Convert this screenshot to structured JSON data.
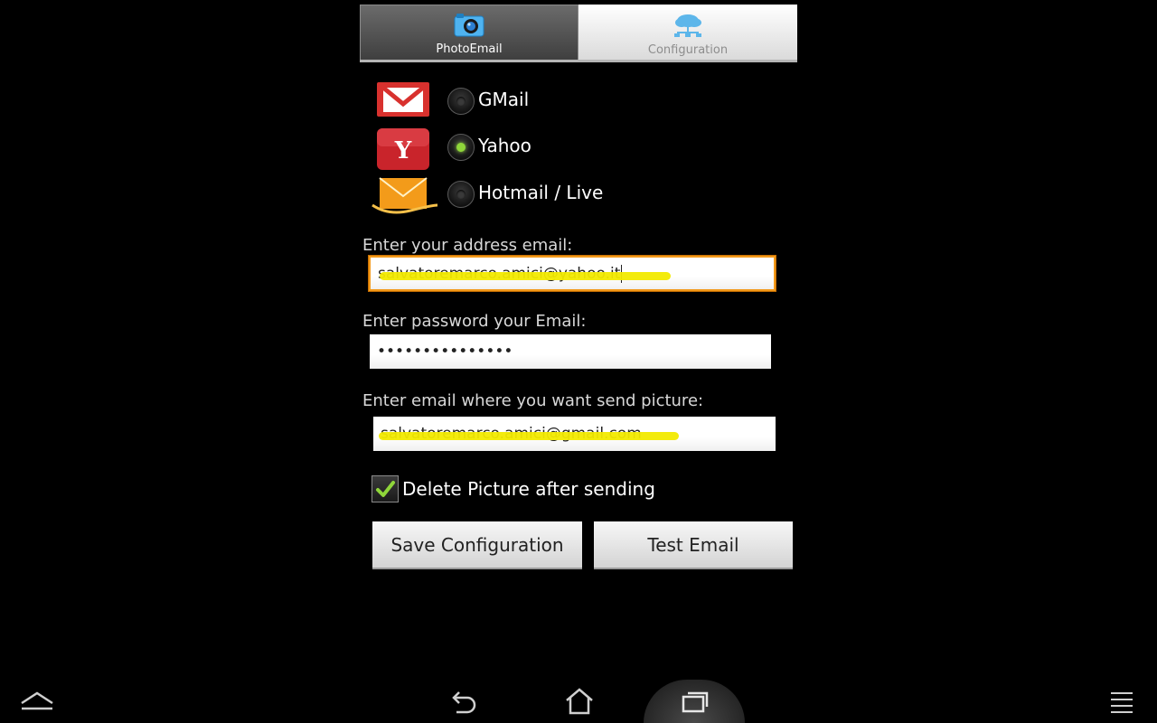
{
  "tabs": [
    {
      "label": "PhotoEmail",
      "icon": "camera-icon",
      "active": true
    },
    {
      "label": "Configuration",
      "icon": "cloud-network-icon",
      "active": false
    }
  ],
  "providers": [
    {
      "label": "GMail",
      "icon": "gmail-icon",
      "selected": false
    },
    {
      "label": "Yahoo",
      "icon": "yahoo-icon",
      "selected": true
    },
    {
      "label": "Hotmail / Live",
      "icon": "hotmail-icon",
      "selected": false
    }
  ],
  "form": {
    "email_label": "Enter your address email:",
    "email_value": "salvatoremarco.amici@yahoo.it",
    "password_label": "Enter password your Email:",
    "password_value": "•••••••••••••••",
    "dest_label": "Enter email where you want send picture:",
    "dest_value": "salvatoremarco.amici@gmail.com"
  },
  "delete_after": {
    "label": "Delete Picture after sending",
    "checked": true
  },
  "buttons": {
    "save": "Save Configuration",
    "test": "Test Email"
  },
  "colors": {
    "focus": "#f39a1b",
    "radio_on": "#8fd63a",
    "highlight": "#f2ea00"
  },
  "navbar": [
    "up-chevron-icon",
    "back-icon",
    "home-icon",
    "recent-apps-icon",
    "menu-icon"
  ]
}
